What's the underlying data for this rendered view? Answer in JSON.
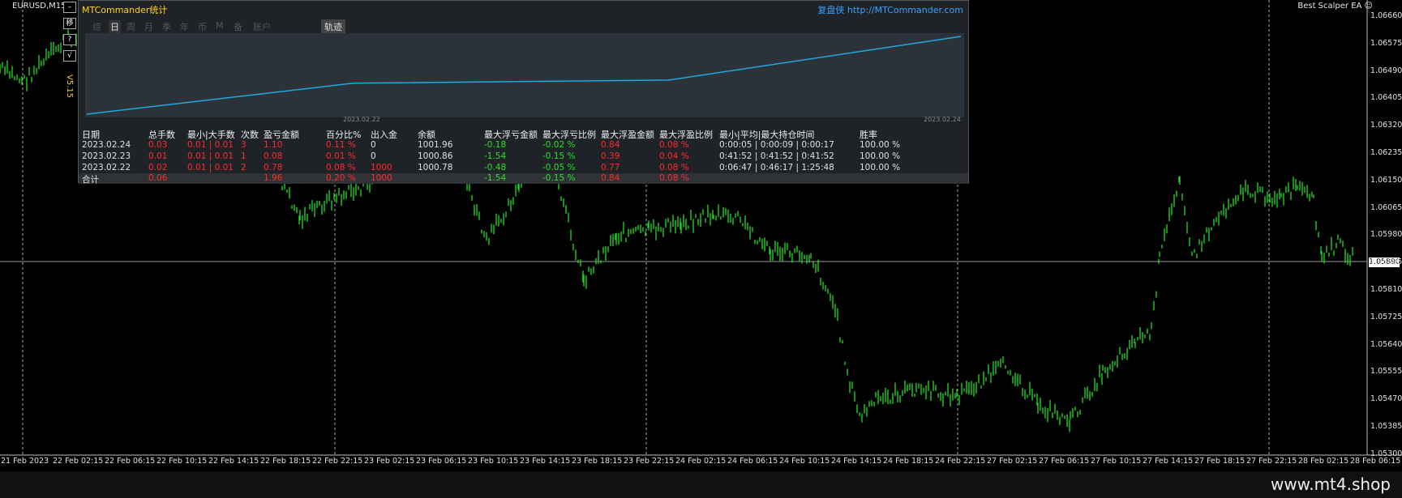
{
  "symbol": "EURUSD,M15",
  "ea_name": "Best Scalper EA ☺",
  "watermark": "www.mt4.shop",
  "current_price": "1.05890",
  "price_labels": [
    "1.06660",
    "1.06575",
    "1.06490",
    "1.06405",
    "1.06320",
    "1.06235",
    "1.06150",
    "1.06065",
    "1.05980",
    "1.05895",
    "1.05810",
    "1.05725",
    "1.05640",
    "1.05555",
    "1.05470",
    "1.05385",
    "1.05300"
  ],
  "time_labels": [
    "21 Feb 2023",
    "22 Feb 02:15",
    "22 Feb 06:15",
    "22 Feb 10:15",
    "22 Feb 14:15",
    "22 Feb 18:15",
    "22 Feb 22:15",
    "23 Feb 02:15",
    "23 Feb 06:15",
    "23 Feb 10:15",
    "23 Feb 14:15",
    "23 Feb 18:15",
    "23 Feb 22:15",
    "24 Feb 02:15",
    "24 Feb 06:15",
    "24 Feb 10:15",
    "24 Feb 14:15",
    "24 Feb 18:15",
    "24 Feb 22:15",
    "27 Feb 02:15",
    "27 Feb 06:15",
    "27 Feb 10:15",
    "27 Feb 14:15",
    "27 Feb 18:15",
    "27 Feb 22:15",
    "28 Feb 02:15",
    "28 Feb 06:15"
  ],
  "side_buttons": [
    "移",
    "?",
    "√"
  ],
  "version": "V5.15",
  "panel": {
    "title": "MTCommander统计",
    "link": "复盘侠 http://MTCommander.com",
    "tabs": [
      "综",
      "日",
      "周",
      "月",
      "季",
      "年",
      "币",
      "M",
      "备",
      "账户"
    ],
    "active_tab": "日",
    "track_tab": "轨迹",
    "graph_dates": [
      "2023.02.22",
      "2023.02.24"
    ],
    "headers": [
      "日期",
      "总手数",
      "最小|大手数",
      "次数",
      "盈亏金额",
      "百分比%",
      "出入金",
      "余额",
      "最大浮亏金额",
      "最大浮亏比例",
      "最大浮盈金额",
      "最大浮盈比例",
      "最小|平均|最大持仓时间",
      "胜率"
    ],
    "rows": [
      [
        "2023.02.24",
        "0.03",
        "0.01 | 0.01",
        "3",
        "1.10",
        "0.11 %",
        "0",
        "1001.96",
        "-0.18",
        "-0.02 %",
        "0.84",
        "0.08 %",
        "0:00:05 | 0:00:09 | 0:00:17",
        "100.00 %"
      ],
      [
        "2023.02.23",
        "0.01",
        "0.01 | 0.01",
        "1",
        "0.08",
        "0.01 %",
        "0",
        "1000.86",
        "-1.54",
        "-0.15 %",
        "0.39",
        "0.04 %",
        "0:41:52 | 0:41:52 | 0:41:52",
        "100.00 %"
      ],
      [
        "2023.02.22",
        "0.02",
        "0.01 | 0.01",
        "2",
        "0.78",
        "0.08 %",
        "1000",
        "1000.78",
        "-0.48",
        "-0.05 %",
        "0.77",
        "0.08 %",
        "0:06:47 | 0:46:17 | 1:25:48",
        "100.00 %"
      ]
    ],
    "total": [
      "合计",
      "0.06",
      "",
      "",
      "1.96",
      "0.20 %",
      "1000",
      "",
      "-1.54",
      "-0.15 %",
      "0.84",
      "0.08 %",
      "",
      ""
    ]
  },
  "colors": {
    "candle": "#22dd22",
    "equity_line": "#1ea8e0",
    "panel_bg": "#1f2328"
  },
  "equity_curve": [
    1000.0,
    1000.78,
    1000.86,
    1001.96
  ]
}
